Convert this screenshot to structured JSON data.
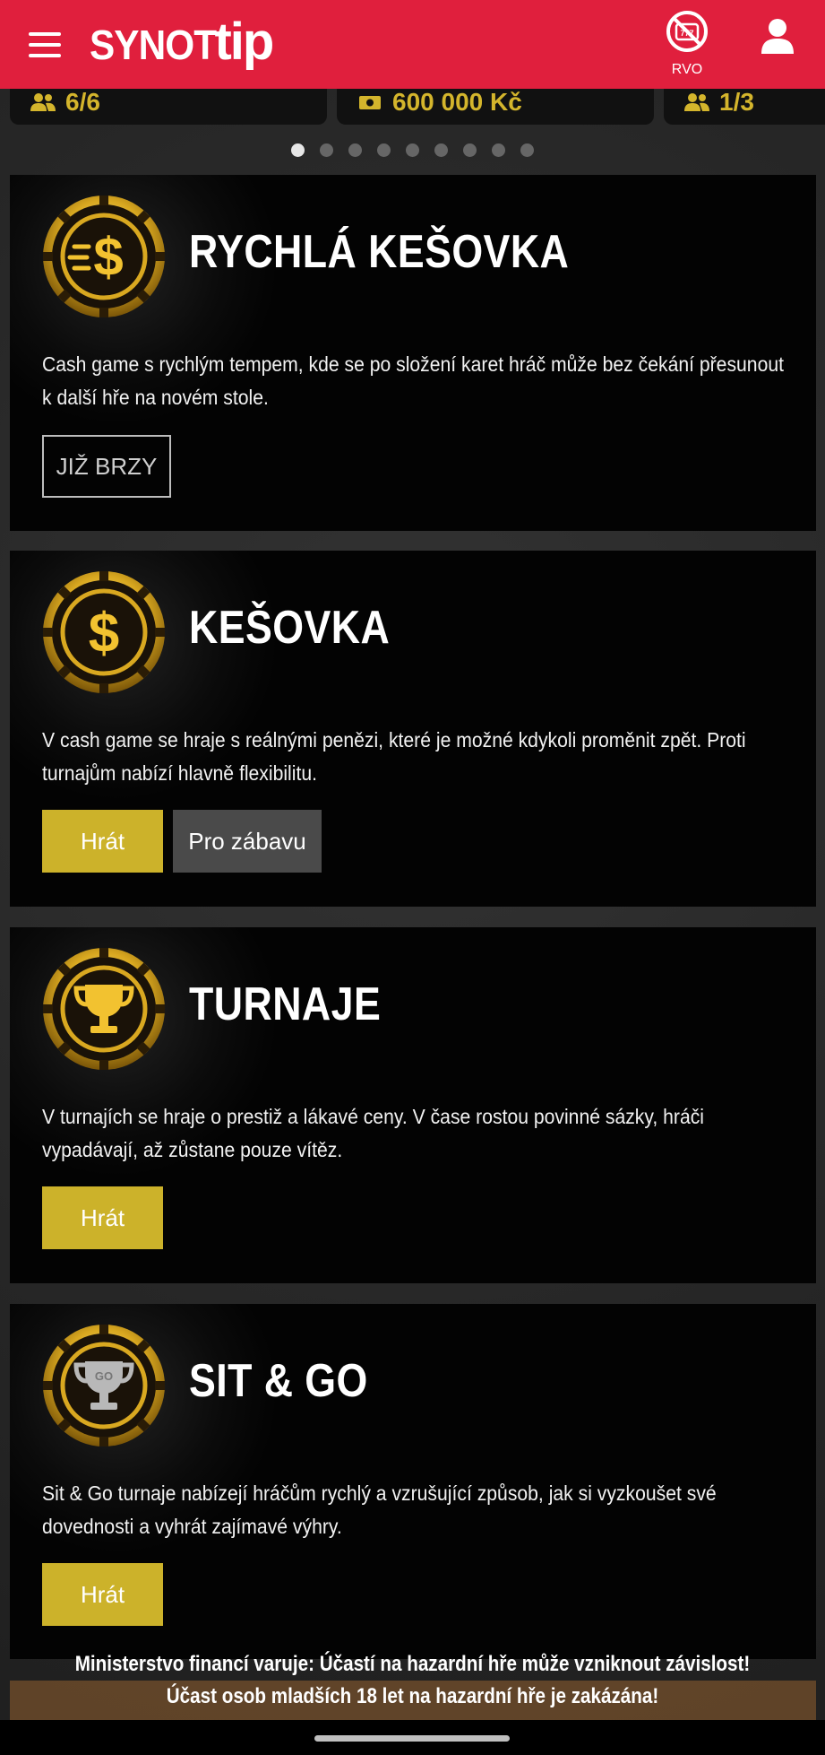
{
  "header": {
    "logo_text_1": "SYNOT",
    "logo_text_2": "tip",
    "rvo_label": "RVO",
    "brand_color": "#e01f3d"
  },
  "strip": {
    "cards": [
      {
        "icon": "users-icon",
        "value": "6/6"
      },
      {
        "icon": "cash-icon",
        "value": "600 000 Kč"
      },
      {
        "icon": "users-icon",
        "value": "1/3"
      }
    ]
  },
  "carousel": {
    "dot_count": 9,
    "active_index": 0
  },
  "cards": [
    {
      "icon": "fast-dollar-chip-icon",
      "title": "RYCHLÁ KEŠOVKA",
      "description": "Cash game s rychlým tempem, kde se po složení karet hráč může bez čekání přesunout k další hře na novém stole.",
      "outline_button": "JIŽ BRZY"
    },
    {
      "icon": "dollar-chip-icon",
      "title": "KEŠOVKA",
      "description": "V cash game se hraje s reálnými penězi, které je možné kdykoli proměnit zpět. Proti turnajům nabízí hlavně flexibilitu.",
      "primary_button": "Hrát",
      "secondary_button": "Pro zábavu"
    },
    {
      "icon": "trophy-chip-icon",
      "title": "TURNAJE",
      "description": "V turnajích se hraje o prestiž a lákavé ceny. V čase rostou povinné sázky, hráči vypadávají, až zůstane pouze vítěz.",
      "primary_button": "Hrát"
    },
    {
      "icon": "sitgo-trophy-chip-icon",
      "title": "SIT & GO",
      "description": "Sit & Go turnaje nabízejí hráčům rychlý a vzrušující způsob, jak si vyzkoušet své dovednosti a vyhrát zajímavé výhry.",
      "primary_button": "Hrát"
    }
  ],
  "warning": {
    "line1": "Ministerstvo financí varuje: Účastí na hazardní hře může vzniknout závislost!",
    "line2": "Účast osob mladších 18 let na hazardní hře je zakázána!"
  },
  "colors": {
    "gold": "#ccb22a",
    "card_bg": "#030303"
  }
}
